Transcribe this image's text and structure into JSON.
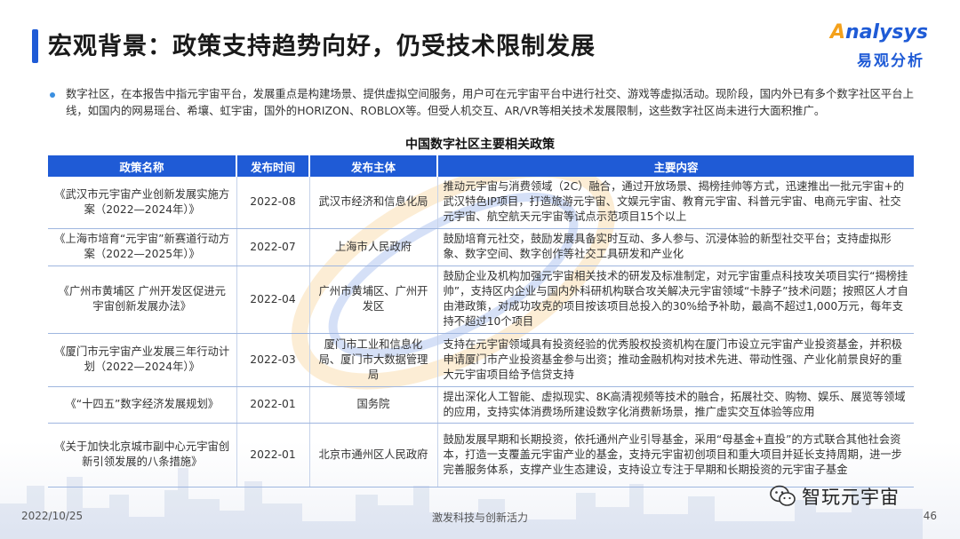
{
  "header": {
    "title": "宏观背景：政策支持趋势向好，仍受技术限制发展",
    "logo_en_prefix": "A",
    "logo_en_rest": "nalysys",
    "logo_cn": "易观分析"
  },
  "intro": "数字社区，在本报告中指元宇宙平台，发展重点是构建场景、提供虚拟空间服务，用户可在元宇宙平台中进行社交、游戏等虚拟活动。现阶段，国内外已有多个数字社区平台上线，如国内的网易瑶台、希壤、虹宇宙，国外的HORIZON、ROBLOX等。但受人机交互、AR/VR等相关技术发展限制，这些数字社区尚未进行大面积推广。",
  "table": {
    "title": "中国数字社区主要相关政策",
    "headers": [
      "政策名称",
      "发布时间",
      "发布主体",
      "主要内容"
    ],
    "rows": [
      {
        "name": "《武汉市元宇宙产业创新发展实施方案（2022—2024年）》",
        "date": "2022-08",
        "publisher": "武汉市经济和信息化局",
        "content": "推动元宇宙与消费领域（2C）融合，通过开放场景、揭榜挂帅等方式，迅速推出一批元宇宙+的武汉特色IP项目，打造旅游元宇宙、文娱元宇宙、教育元宇宙、科普元宇宙、电商元宇宙、社交元宇宙、航空航天元宇宙等试点示范项目15个以上"
      },
      {
        "name": "《上海市培育“元宇宙”新赛道行动方案（2022—2025年）》",
        "date": "2022-07",
        "publisher": "上海市人民政府",
        "content": "鼓励培育元社交，鼓励发展具备实时互动、多人参与、沉浸体验的新型社交平台；支持虚拟形象、数字空间、数字创作等社交工具研发和产业化"
      },
      {
        "name": "《广州市黄埔区 广州开发区促进元宇宙创新发展办法》",
        "date": "2022-04",
        "publisher": "广州市黄埔区、广州开发区",
        "content": "鼓励企业及机构加强元宇宙相关技术的研发及标准制定，对元宇宙重点科技攻关项目实行“揭榜挂帅”，支持区内企业与国内外科研机构联合攻关解决元宇宙领域“卡脖子”技术问题；按照区人才自由港政策，对成功攻克的项目按该项目总投入的30%给予补助，最高不超过1,000万元，每年支持不超过10个项目"
      },
      {
        "name": "《厦门市元宇宙产业发展三年行动计划（2022—2024年）》",
        "date": "2022-03",
        "publisher": "厦门市工业和信息化局、厦门市大数据管理局",
        "content": "支持在元宇宙领域具有投资经验的优秀股权投资机构在厦门市设立元宇宙产业投资基金，并积极申请厦门市产业投资基金参与出资；推动金融机构对技术先进、带动性强、产业化前景良好的重大元宇宙项目给予信贷支持"
      },
      {
        "name": "《“十四五”数字经济发展规划》",
        "date": "2022-01",
        "publisher": "国务院",
        "content": "提出深化人工智能、虚拟现实、8K高清视频等技术的融合，拓展社交、购物、娱乐、展览等领域的应用，支持实体消费场所建设数字化消费新场景，推广虚实交互体验等应用"
      },
      {
        "name": "《关于加快北京城市副中心元宇宙创新引领发展的八条措施》",
        "date": "2022-01",
        "publisher": "北京市通州区人民政府",
        "content": "鼓励发展早期和长期投资，依托通州产业引导基金，采用“母基金+直投”的方式联合其他社会资本，打造一支覆盖元宇宙产业的基金，支持元宇宙初创项目和重大项目并延长支持周期，进一步完善服务体系，支撑产业生态建设，支持设立专注于早期和长期投资的元宇宙子基金"
      }
    ]
  },
  "footer": {
    "date": "2022/10/25",
    "slogan": "激发科技与创新活力",
    "page": "46",
    "wechat_label": "智玩元宇宙"
  },
  "colors": {
    "accent": "#1f5bd6",
    "logo_orange": "#f4a11b",
    "bullet": "#3b8fe0"
  },
  "icons": [
    "wechat-icon",
    "bullet-dot-icon",
    "analysys-logo"
  ]
}
